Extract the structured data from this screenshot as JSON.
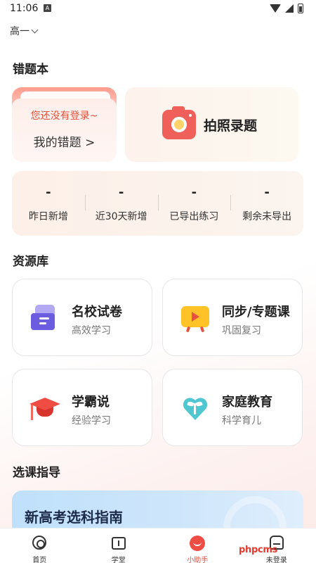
{
  "status_bar": {
    "time": "11:06",
    "notification": "A"
  },
  "grade_selector": {
    "label": "高一"
  },
  "mistake_section": {
    "title": "错题本",
    "mistake_card": {
      "notice": "您还没有登录~",
      "label": "我的错题 >"
    },
    "photo_card": {
      "label": "拍照录题"
    },
    "stats": [
      {
        "value": "-",
        "label": "昨日新增"
      },
      {
        "value": "-",
        "label": "近30天新增"
      },
      {
        "value": "-",
        "label": "已导出练习"
      },
      {
        "value": "-",
        "label": "剩余未导出"
      }
    ]
  },
  "resource_section": {
    "title": "资源库",
    "items": [
      {
        "title": "名校试卷",
        "subtitle": "高效学习",
        "icon": "paper-icon"
      },
      {
        "title": "同步/专题课",
        "subtitle": "巩固复习",
        "icon": "video-icon"
      },
      {
        "title": "学霸说",
        "subtitle": "经验学习",
        "icon": "graduation-cap-icon"
      },
      {
        "title": "家庭教育",
        "subtitle": "科学育儿",
        "icon": "heart-sprout-icon"
      }
    ]
  },
  "course_section": {
    "title": "选课指导",
    "banner_title": "新高考选科指南"
  },
  "tabbar": {
    "tabs": [
      {
        "label": "首页"
      },
      {
        "label": "学堂"
      },
      {
        "label": "小助手"
      },
      {
        "label": "未登录"
      }
    ],
    "active_color": "#e94a3a"
  },
  "watermark": "phpcms"
}
